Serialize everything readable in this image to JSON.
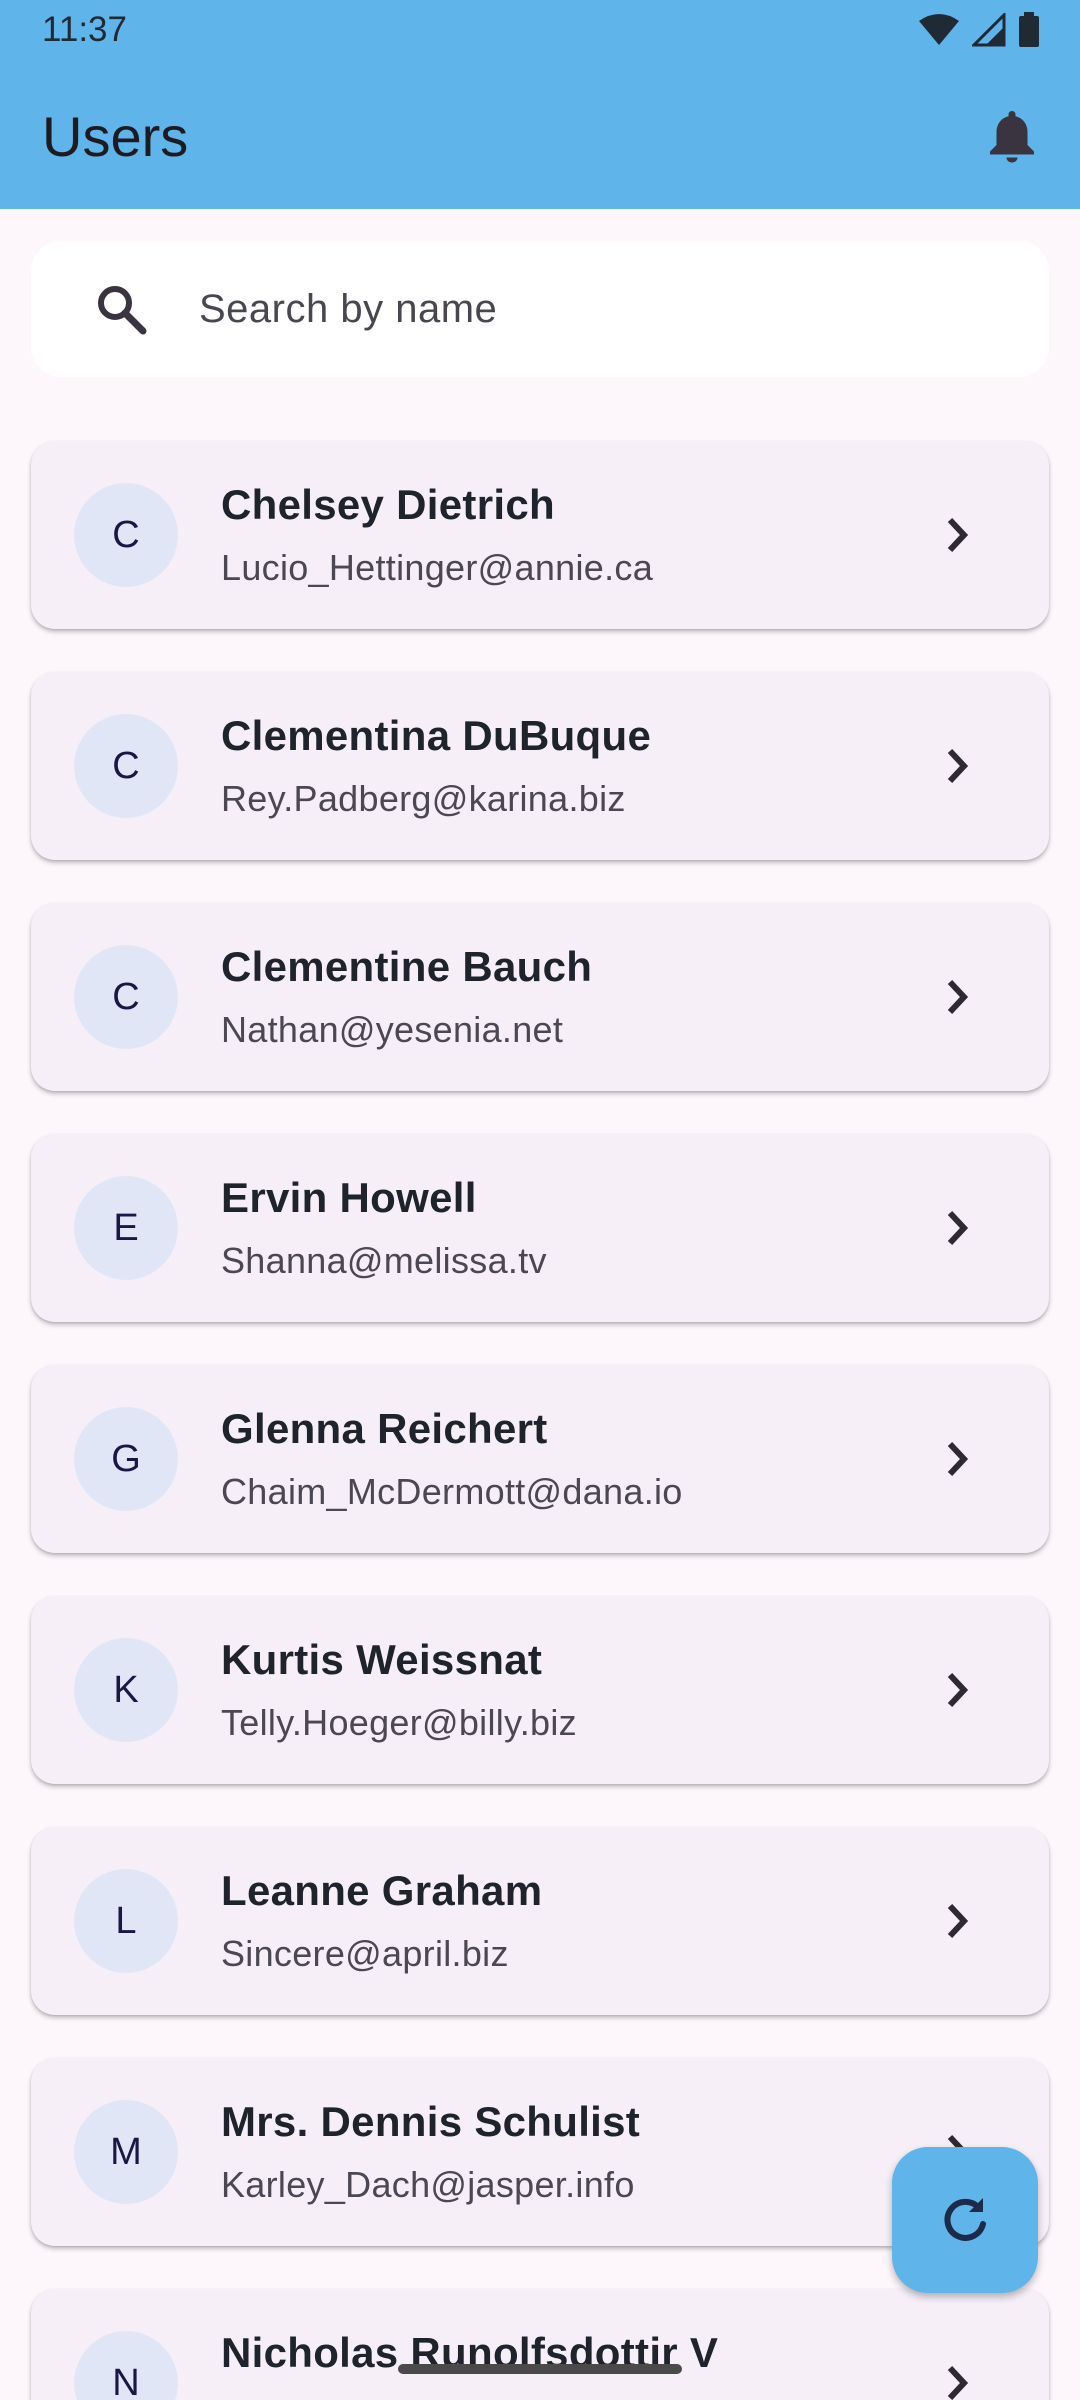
{
  "status_bar": {
    "time": "11:37",
    "icons": [
      "wifi-icon",
      "cellular-signal-icon",
      "battery-icon"
    ]
  },
  "app_bar": {
    "title": "Users",
    "action_icon": "bell-icon"
  },
  "search": {
    "placeholder": "Search by name",
    "value": "",
    "icon": "search-icon"
  },
  "users": [
    {
      "initial": "C",
      "name": "Chelsey Dietrich",
      "email": "Lucio_Hettinger@annie.ca"
    },
    {
      "initial": "C",
      "name": "Clementina DuBuque",
      "email": "Rey.Padberg@karina.biz"
    },
    {
      "initial": "C",
      "name": "Clementine Bauch",
      "email": "Nathan@yesenia.net"
    },
    {
      "initial": "E",
      "name": "Ervin Howell",
      "email": "Shanna@melissa.tv"
    },
    {
      "initial": "G",
      "name": "Glenna Reichert",
      "email": "Chaim_McDermott@dana.io"
    },
    {
      "initial": "K",
      "name": "Kurtis Weissnat",
      "email": "Telly.Hoeger@billy.biz"
    },
    {
      "initial": "L",
      "name": "Leanne Graham",
      "email": "Sincere@april.biz"
    },
    {
      "initial": "M",
      "name": "Mrs. Dennis Schulist",
      "email": "Karley_Dach@jasper.info"
    },
    {
      "initial": "N",
      "name": "Nicholas Runolfsdottir V",
      "email": ""
    }
  ],
  "fab": {
    "icon": "refresh-icon"
  },
  "colors": {
    "app_bar": "#5FB4EA",
    "background": "#FDF7FC",
    "card": "#F6EFF8",
    "avatar": "#E1E6F7"
  }
}
